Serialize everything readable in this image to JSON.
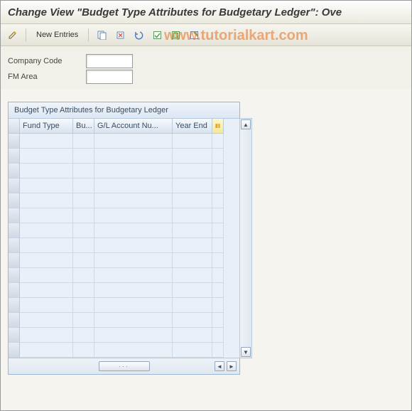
{
  "title": "Change View \"Budget Type Attributes for Budgetary Ledger\": Ove",
  "watermark": "www.tutorialkart.com",
  "toolbar": {
    "new_entries": "New Entries"
  },
  "form": {
    "company_code": {
      "label": "Company Code",
      "value": ""
    },
    "fm_area": {
      "label": "FM Area",
      "value": ""
    }
  },
  "table": {
    "title": "Budget Type Attributes for Budgetary Ledger",
    "columns": {
      "fund_type": "Fund Type",
      "bu": "Bu...",
      "gl_acct": "G/L Account Nu...",
      "year_end": "Year End"
    },
    "row_count": 15
  }
}
